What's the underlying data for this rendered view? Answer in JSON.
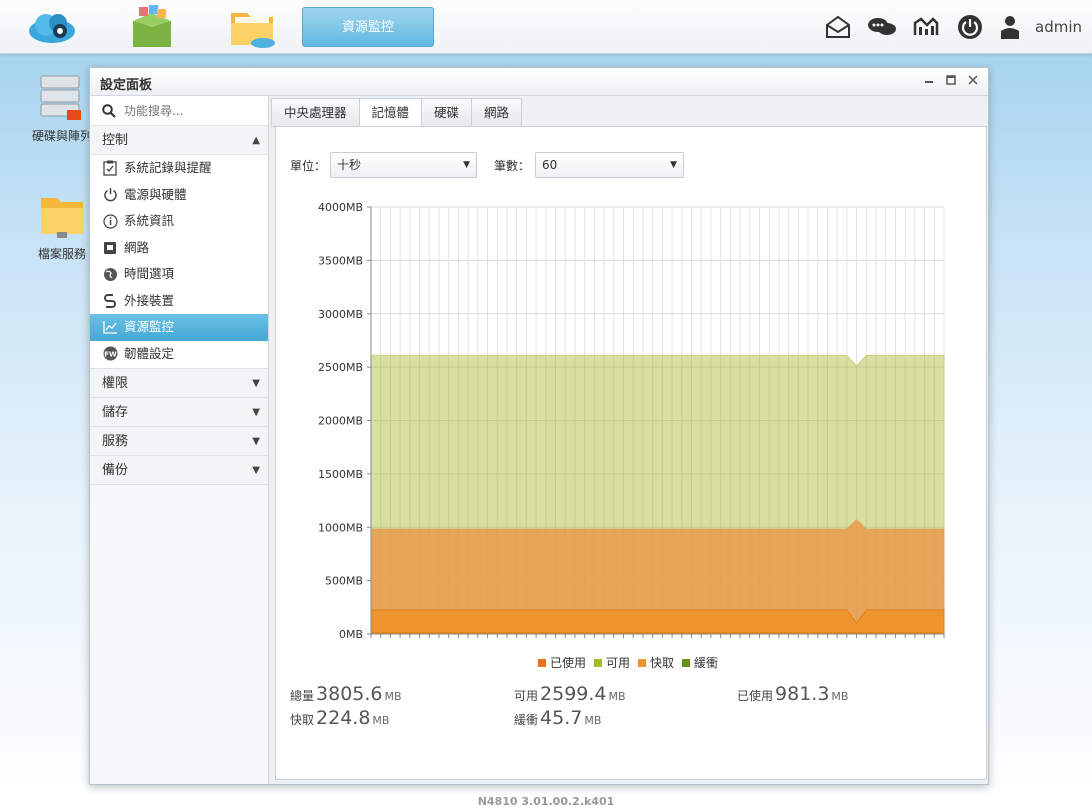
{
  "taskbar": {
    "active_app": "資源監控",
    "admin": "admin"
  },
  "desktop": {
    "icons": [
      {
        "label": "硬碟與陣列"
      },
      {
        "label": "檔案服務"
      }
    ]
  },
  "window": {
    "title": "設定面板"
  },
  "sidebar": {
    "search_placeholder": "功能搜尋...",
    "control_section": "控制",
    "control_items": [
      {
        "label": "系統記錄與提醒",
        "icon": "clipboard-icon"
      },
      {
        "label": "電源與硬體",
        "icon": "power-icon"
      },
      {
        "label": "系統資訊",
        "icon": "info-icon"
      },
      {
        "label": "網路",
        "icon": "network-icon"
      },
      {
        "label": "時間選項",
        "icon": "globe-icon"
      },
      {
        "label": "外接裝置",
        "icon": "usb-icon"
      },
      {
        "label": "資源監控",
        "icon": "chart-icon",
        "selected": true
      },
      {
        "label": "韌體設定",
        "icon": "firmware-icon"
      }
    ],
    "sections": [
      {
        "label": "權限"
      },
      {
        "label": "儲存"
      },
      {
        "label": "服務"
      },
      {
        "label": "備份"
      }
    ]
  },
  "tabs": [
    {
      "label": "中央處理器"
    },
    {
      "label": "記憶體",
      "active": true
    },
    {
      "label": "硬碟"
    },
    {
      "label": "網路"
    }
  ],
  "controls": {
    "unit_label": "單位：",
    "unit_value": "十秒",
    "count_label": "筆數：",
    "count_value": "60"
  },
  "chart_data": {
    "type": "area",
    "y_ticks": [
      "4000MB",
      "3500MB",
      "3000MB",
      "2500MB",
      "2000MB",
      "1500MB",
      "1000MB",
      "500MB",
      "0MB"
    ],
    "ylim": [
      0,
      4000
    ],
    "grid": true,
    "series": [
      {
        "name": "已使用",
        "color": "#e8731c",
        "value": 981.3,
        "dip_value": 1070
      },
      {
        "name": "可用",
        "color": "#a6bb2a",
        "value": 2599.4
      },
      {
        "name": "快取",
        "color": "#f0922b",
        "value": 224.8,
        "dip_value": 100
      },
      {
        "name": "緩衝",
        "color": "#6a8f1f",
        "value": 45.7
      }
    ],
    "top_total": 2610,
    "top_dip": 2510,
    "points": 60
  },
  "stats": {
    "total_label": "總量",
    "total_value": "3805.6",
    "total_unit": "MB",
    "avail_label": "可用",
    "avail_value": "2599.4",
    "avail_unit": "MB",
    "used_label": "已使用",
    "used_value": "981.3",
    "used_unit": "MB",
    "cache_label": "快取",
    "cache_value": "224.8",
    "cache_unit": "MB",
    "buffer_label": "緩衝",
    "buffer_value": "45.7",
    "buffer_unit": "MB"
  },
  "footer": "N4810   3.01.00.2.k401"
}
